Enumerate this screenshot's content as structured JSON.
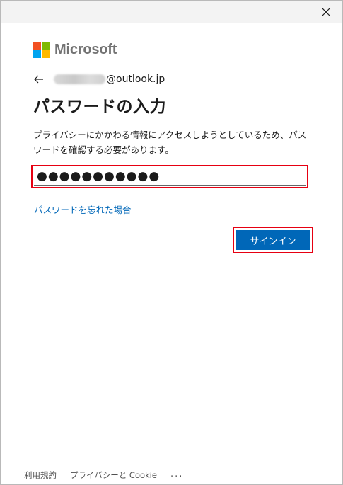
{
  "window": {
    "close_icon": "close-icon"
  },
  "brand": {
    "name": "Microsoft",
    "colors": [
      "#f25022",
      "#7fba00",
      "#00a4ef",
      "#ffb900"
    ]
  },
  "identity": {
    "back_icon": "back-arrow-icon",
    "email_domain": "@outlook.jp"
  },
  "heading": "パスワードの入力",
  "description": "プライバシーにかかわる情報にアクセスしようとしているため、パスワードを確認する必要があります。",
  "password": {
    "value": "●●●●●●●●●●●"
  },
  "forgot_link": "パスワードを忘れた場合",
  "signin_button": "サインイン",
  "footer": {
    "terms": "利用規約",
    "privacy": "プライバシーと Cookie",
    "more": "..."
  },
  "colors": {
    "accent": "#0067b8",
    "highlight": "#e60012"
  }
}
